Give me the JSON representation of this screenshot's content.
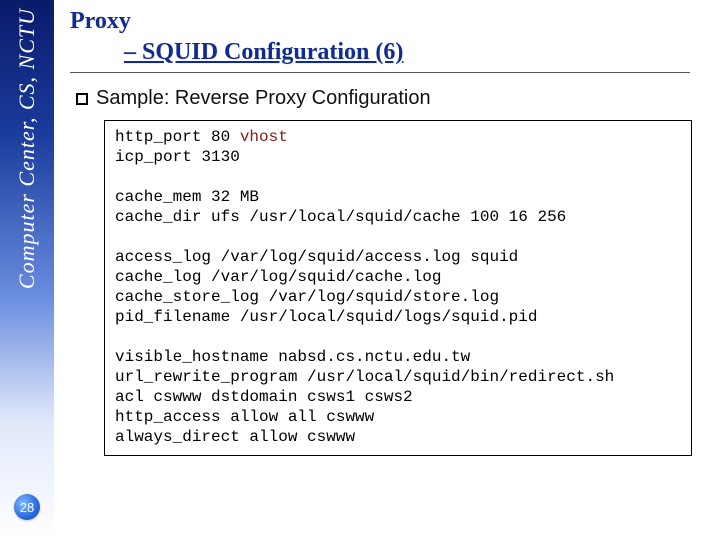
{
  "sidebar": {
    "org_label": "Computer Center, CS, NCTU"
  },
  "slide": {
    "number": "28",
    "title_line1": "Proxy",
    "title_line2": "– SQUID Configuration (6)",
    "bullet": "Sample: Reverse Proxy Configuration"
  },
  "config": {
    "l01a": "http_port 80 ",
    "l01b": "vhost",
    "l02": "icp_port 3130",
    "l03": "cache_mem 32 MB",
    "l04": "cache_dir ufs /usr/local/squid/cache 100 16 256",
    "l05": "access_log /var/log/squid/access.log squid",
    "l06": "cache_log /var/log/squid/cache.log",
    "l07": "cache_store_log /var/log/squid/store.log",
    "l08": "pid_filename /usr/local/squid/logs/squid.pid",
    "l09": "visible_hostname nabsd.cs.nctu.edu.tw",
    "l10": "url_rewrite_program /usr/local/squid/bin/redirect.sh",
    "l11": "acl cswww dstdomain csws1 csws2",
    "l12": "http_access allow all cswww",
    "l13": "always_direct allow cswww"
  }
}
